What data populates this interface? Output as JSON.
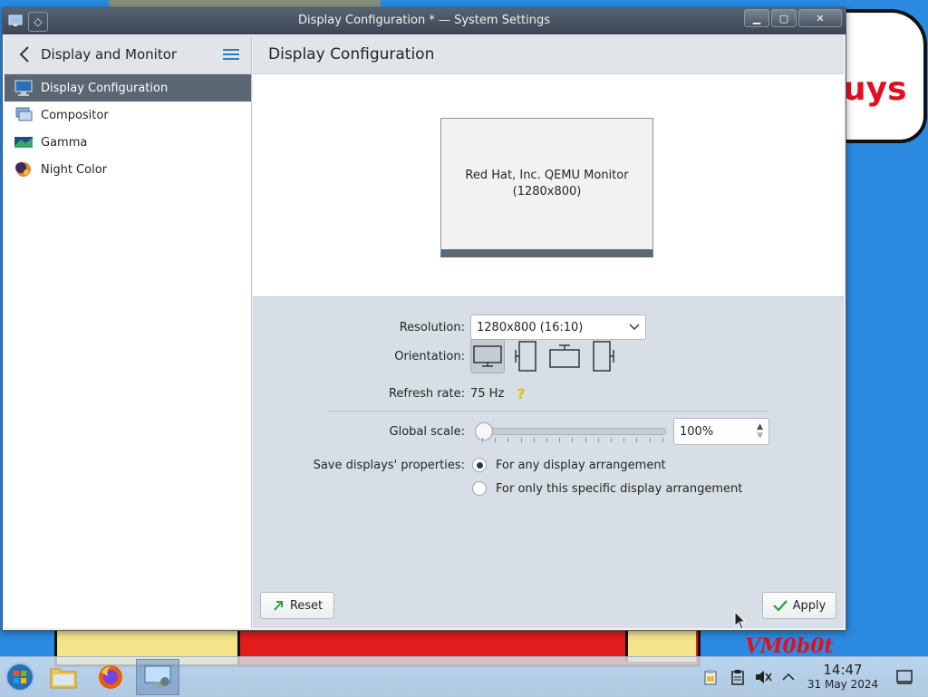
{
  "window": {
    "title": "Display Configuration * — System Settings",
    "buttons": {
      "minimize": "▁",
      "maximize": "▢",
      "close": "✕"
    }
  },
  "sidebar": {
    "header": "Display and Monitor",
    "items": [
      {
        "label": "Display Configuration",
        "active": true,
        "icon": "display-config-icon"
      },
      {
        "label": "Compositor",
        "active": false,
        "icon": "compositor-icon"
      },
      {
        "label": "Gamma",
        "active": false,
        "icon": "gamma-icon"
      },
      {
        "label": "Night Color",
        "active": false,
        "icon": "night-color-icon"
      }
    ]
  },
  "main": {
    "title": "Display Configuration",
    "monitor": {
      "name": "Red Hat, Inc. QEMU Monitor",
      "resolution": "(1280x800)"
    },
    "resolution_label": "Resolution:",
    "resolution_value": "1280x800 (16:10)",
    "orientation_label": "Orientation:",
    "refresh_label": "Refresh rate:",
    "refresh_value": "75 Hz",
    "scale_label": "Global scale:",
    "scale_value": "100%",
    "scale_level": 0,
    "save_label": "Save displays' properties:",
    "save_options": [
      {
        "label": "For any display arrangement",
        "checked": true
      },
      {
        "label": "For only this specific display arrangement",
        "checked": false
      }
    ],
    "reset_label": "Reset",
    "apply_label": "Apply"
  },
  "taskbar": {
    "time": "14:47",
    "date": "31 May 2024"
  },
  "desktop": {
    "cloud_text": "uys",
    "brand_text": "VM0b0t"
  },
  "colors": {
    "sidebar_active": "#5a6672",
    "accent": "#2980b9",
    "window_bg": "#d8dee5"
  }
}
